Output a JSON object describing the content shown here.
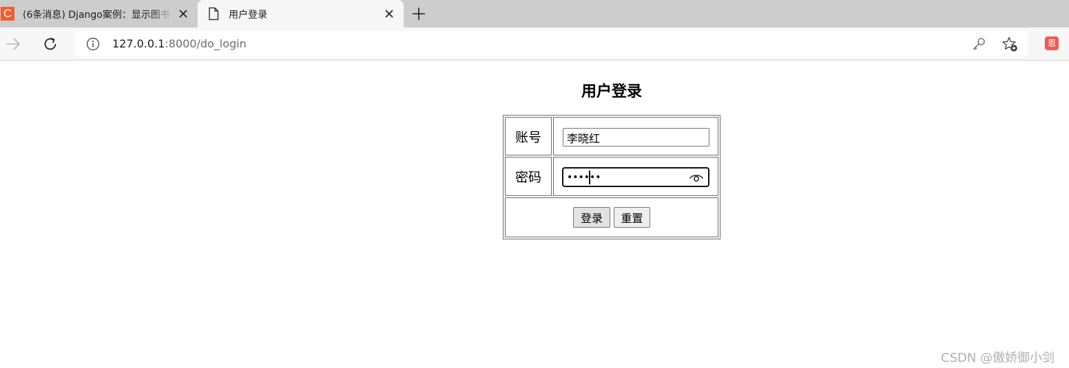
{
  "browser": {
    "tabs": [
      {
        "title": "(6条消息) Django案例：显示图书",
        "favicon": "C",
        "active": false
      },
      {
        "title": "用户登录",
        "active": true
      }
    ],
    "address": {
      "host": "127.0.0.1",
      "rest": ":8000/do_login"
    },
    "extension_badge": "恩",
    "icons": [
      "forward-icon",
      "refresh-icon",
      "info-icon",
      "key-icon",
      "favorites-add-icon",
      "close-icon",
      "new-tab-icon",
      "page-icon"
    ]
  },
  "page": {
    "title": "用户登录",
    "form": {
      "account_label": "账号",
      "account_value": "李晓红",
      "password_label": "密码",
      "password_masked": "••••••",
      "login_button": "登录",
      "reset_button": "重置"
    }
  },
  "watermark": "CSDN @傲娇御小剑",
  "colors": {
    "tabstrip": "#cdcdcd",
    "toolbar": "#f7f7f7",
    "favicon_c": "#f55b2c",
    "extension": "#f05a52"
  }
}
